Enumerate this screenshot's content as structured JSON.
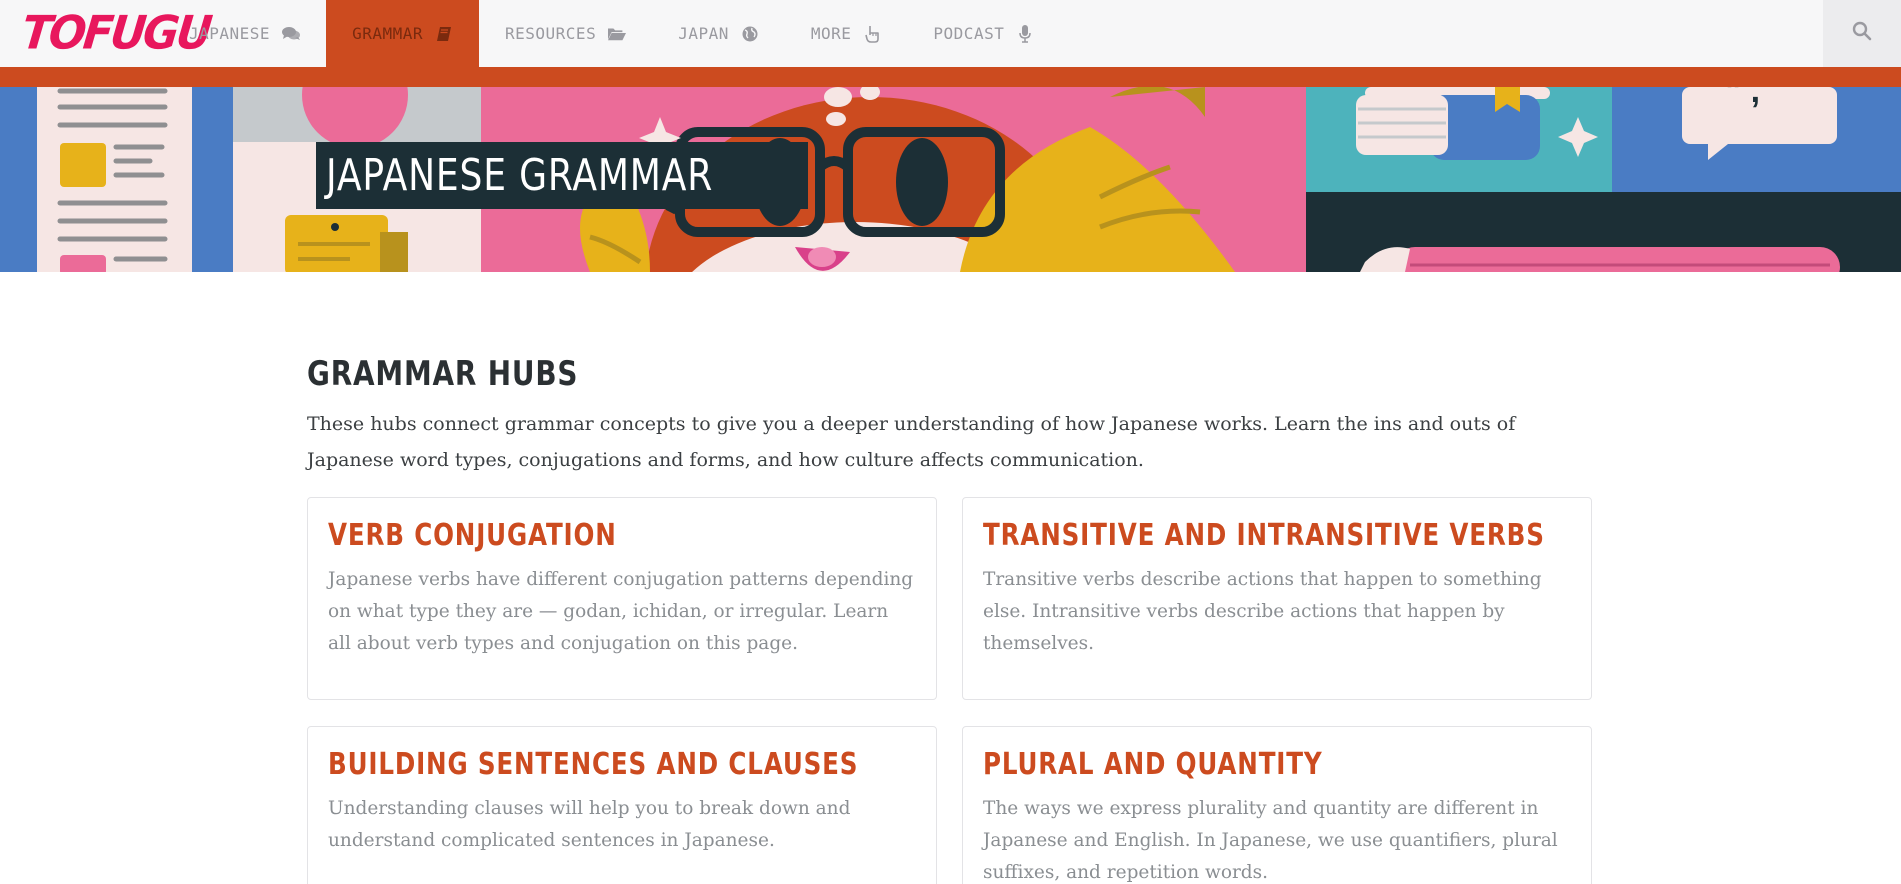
{
  "brand": {
    "logo_text": "TOFUGU"
  },
  "nav": {
    "items": [
      {
        "label": "JAPANESE",
        "icon": "chat-bubbles-icon",
        "active": false
      },
      {
        "label": "GRAMMAR",
        "icon": "book-icon",
        "active": true
      },
      {
        "label": "RESOURCES",
        "icon": "folder-open-icon",
        "active": false
      },
      {
        "label": "JAPAN",
        "icon": "globe-icon",
        "active": false
      },
      {
        "label": "MORE",
        "icon": "hand-pointer-icon",
        "active": false
      },
      {
        "label": "PODCAST",
        "icon": "microphone-icon",
        "active": false
      }
    ],
    "search_icon": "search-icon"
  },
  "hero": {
    "title": "JAPANESE GRAMMAR"
  },
  "section": {
    "title": "GRAMMAR HUBS",
    "intro": "These hubs connect grammar concepts to give you a deeper understanding of how Japanese works. Learn the ins and outs of Japanese word types, conjugations and forms, and how culture affects communication."
  },
  "cards": [
    {
      "title": "VERB CONJUGATION",
      "description": "Japanese verbs have different conjugation patterns depending on what type they are — godan, ichidan, or irregular. Learn all about verb types and conjugation on this page."
    },
    {
      "title": "TRANSITIVE AND INTRANSITIVE VERBS",
      "description": "Transitive verbs describe actions that happen to something else. Intransitive verbs describe actions that happen by themselves."
    },
    {
      "title": "BUILDING SENTENCES AND CLAUSES",
      "description": "Understanding clauses will help you to break down and understand complicated sentences in Japanese."
    },
    {
      "title": "PLURAL AND QUANTITY",
      "description": "The ways we express plurality and quantity are different in Japanese and English. In Japanese, we use quantifiers, plural suffixes, and repetition words."
    }
  ],
  "colors": {
    "accent": "#cc4b1f",
    "logo": "#e8175d",
    "hero_title_bg": "#1c2f36",
    "hero_pink": "#eb6b98",
    "hero_blue": "#4a7cc4",
    "hero_teal": "#4db3bc",
    "hero_yellow": "#e7b21a"
  }
}
